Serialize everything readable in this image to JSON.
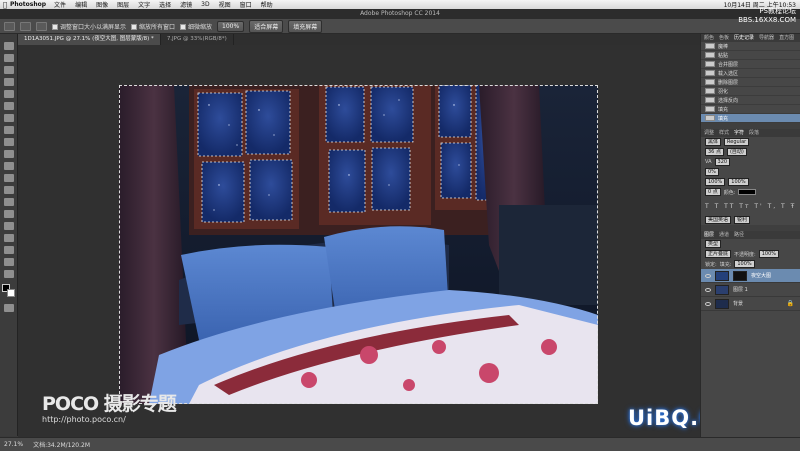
{
  "menubar": {
    "app_name": "Photoshop",
    "items": [
      "文件",
      "编辑",
      "图像",
      "图层",
      "文字",
      "选择",
      "滤镜",
      "3D",
      "视图",
      "窗口",
      "帮助"
    ],
    "clock": "10月14日 周二 上午10:53"
  },
  "window_title": "Adobe Photoshop CC 2014",
  "watermark_top": {
    "line1": "PS教程论坛",
    "line2": "BBS.16XX8.COM"
  },
  "options_bar": {
    "opt1": "调整窗口大小以满屏显示",
    "opt2": "缩放所有窗口",
    "opt3": "细微缩放",
    "btn_100": "100%",
    "btn_fit": "适合屏幕",
    "btn_fill": "填充屏幕"
  },
  "tabs": [
    {
      "label": "1D1A3051.JPG @ 27.1% (夜空大图, 图层蒙版/8) *"
    },
    {
      "label": "7.JPG @ 33%(RGB/8*)"
    }
  ],
  "history_panel": {
    "tabs": [
      "颜色",
      "色板",
      "历史记录",
      "导航器",
      "直方图"
    ],
    "items": [
      "魔棒",
      "粘贴",
      "合并图层",
      "载入选区",
      "删除图层",
      "羽化",
      "选择反向",
      "填充",
      "填充"
    ]
  },
  "character_panel": {
    "tabs": [
      "调整",
      "样式",
      "字符",
      "段落"
    ],
    "font": "黑体",
    "style": "Regular",
    "size": "36 点",
    "leading": "(自动)",
    "kerning": "VA",
    "tracking": "320",
    "scale_pct": "0%",
    "vscale": "100%",
    "hscale": "100%",
    "baseline": "0 点",
    "color_label": "颜色:",
    "lang": "美国英语",
    "aa": "锐利"
  },
  "layers_panel": {
    "tabs": [
      "图层",
      "通道",
      "路径"
    ],
    "kind": "类型",
    "blend": "正片叠底",
    "opacity_label": "不透明度:",
    "opacity": "100%",
    "lock_label": "锁定:",
    "fill_label": "填充:",
    "fill": "100%",
    "layers": [
      "夜空大图",
      "图层 1",
      "背景"
    ]
  },
  "statusbar": {
    "zoom": "27.1%",
    "doc": "文档:34.2M/120.2M"
  },
  "watermarks": {
    "poco": "POCO 摄影专题",
    "poco_url": "http://photo.poco.cn/",
    "uibq": "UiBQ.CoM"
  }
}
